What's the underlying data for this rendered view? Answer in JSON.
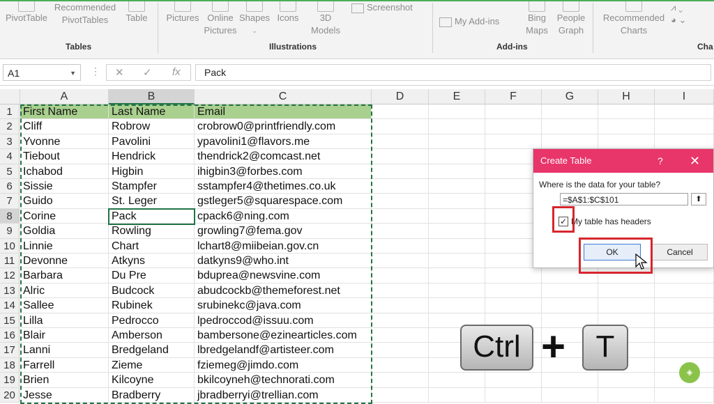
{
  "ribbon": {
    "buttons": [
      {
        "label": "PivotTable"
      },
      {
        "label": "Recommended PivotTables"
      },
      {
        "label": "Table"
      },
      {
        "label": "Pictures"
      },
      {
        "label": "Online Pictures"
      },
      {
        "label": "Shapes"
      },
      {
        "label": "Icons"
      },
      {
        "label": "3D Models"
      },
      {
        "label": "Screenshot"
      },
      {
        "label": "My Add-ins"
      },
      {
        "label": "Bing Maps"
      },
      {
        "label": "People Graph"
      },
      {
        "label": "Recommended Charts"
      }
    ],
    "groups": [
      "Tables",
      "Illustrations",
      "Add-ins",
      "Cha"
    ]
  },
  "formula_bar": {
    "name_box": "A1",
    "fx": "fx",
    "content": "Pack"
  },
  "columns": [
    "A",
    "B",
    "C",
    "D",
    "E",
    "F",
    "G",
    "H",
    "I"
  ],
  "rows": [
    [
      "First Name",
      "Last Name",
      "Email"
    ],
    [
      "Cliff",
      "Robrow",
      "crobrow0@printfriendly.com"
    ],
    [
      "Yvonne",
      "Pavolini",
      "ypavolini1@flavors.me"
    ],
    [
      "Tiebout",
      "Hendrick",
      "thendrick2@comcast.net"
    ],
    [
      "Ichabod",
      "Higbin",
      "ihigbin3@forbes.com"
    ],
    [
      "Sissie",
      "Stampfer",
      "sstampfer4@thetimes.co.uk"
    ],
    [
      "Guido",
      "St. Leger",
      "gstleger5@squarespace.com"
    ],
    [
      "Corine",
      "Pack",
      "cpack6@ning.com"
    ],
    [
      "Goldia",
      "Rowling",
      "growling7@fema.gov"
    ],
    [
      "Linnie",
      "Chart",
      "lchart8@miibeian.gov.cn"
    ],
    [
      "Devonne",
      "Atkyns",
      "datkyns9@who.int"
    ],
    [
      "Barbara",
      "Du Pre",
      "bduprea@newsvine.com"
    ],
    [
      "Alric",
      "Budcock",
      "abudcockb@themeforest.net"
    ],
    [
      "Sallee",
      "Rubinek",
      "srubinekc@java.com"
    ],
    [
      "Lilla",
      "Pedrocco",
      "lpedroccod@issuu.com"
    ],
    [
      "Blair",
      "Amberson",
      "bambersone@ezinearticles.com"
    ],
    [
      "Lanni",
      "Bredgeland",
      "lbredgelandf@artisteer.com"
    ],
    [
      "Farrell",
      "Zieme",
      "fziemeg@jimdo.com"
    ],
    [
      "Brien",
      "Kilcoyne",
      "bkilcoyneh@technorati.com"
    ],
    [
      "Jesse",
      "Bradberry",
      "jbradberryi@trellian.com"
    ]
  ],
  "dialog": {
    "title": "Create Table",
    "help": "?",
    "close": "✕",
    "question": "Where is the data for your table?",
    "range": "=$A$1:$C$101",
    "checkbox_checked": true,
    "checkbox_label": "My table has headers",
    "ok": "OK",
    "cancel": "Cancel"
  },
  "shortcut": {
    "key1": "Ctrl",
    "plus": "+",
    "key2": "T"
  },
  "colors": {
    "header_fill": "#a9d08e",
    "excel_green": "#217346",
    "dialog_title": "#e8356a",
    "highlight": "#d7262d"
  }
}
